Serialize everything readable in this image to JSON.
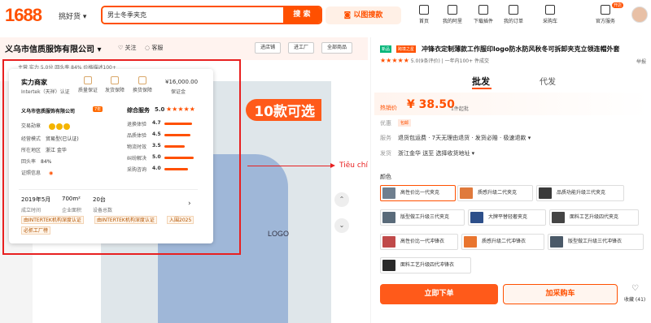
{
  "header": {
    "logo": "1688",
    "selector": "挑好货 ▾",
    "search_value": "男士冬季夹克",
    "search_button": "搜 索",
    "image_search": "以图搜款",
    "nav": [
      {
        "label": "首页",
        "icon": "home-icon"
      },
      {
        "label": "我的阿里",
        "icon": "user-icon"
      },
      {
        "label": "下载插件",
        "icon": "download-icon"
      },
      {
        "label": "我的订单",
        "icon": "order-icon"
      },
      {
        "label": "采购车",
        "icon": "cart-icon"
      },
      {
        "label": "官方服务",
        "icon": "service-icon"
      }
    ],
    "open_badge": "开店"
  },
  "store": {
    "name": "义乌市信质服饰有限公司 ▾",
    "follow": "关注",
    "follow2": "客服",
    "buttons": [
      "进店铺",
      "进工厂",
      "全部商品"
    ],
    "subbar": "主营  实力  5.0分  回头率 84%  价格描述100+"
  },
  "main_image": {
    "banner": "10款可选",
    "logo_print": "LOGO"
  },
  "popup": {
    "title": "实力商家",
    "cert": "Intertek（天祥）认证",
    "guarantees": [
      "质量保证",
      "发货保障",
      "换货保障"
    ],
    "money": "¥16,000.00",
    "money_label": "保证金",
    "company": "义乌市信质服饰有限公司",
    "years": "7年",
    "rows": [
      {
        "label": "交易勋章",
        "value": ""
      },
      {
        "label": "经营模式",
        "value": "贸易型(已认证)"
      },
      {
        "label": "所在地区",
        "value": "浙江 金华"
      },
      {
        "label": "回头率",
        "value": "84%"
      },
      {
        "label": "证照信息",
        "value": ""
      }
    ],
    "score_title": "综合服务",
    "score_value": "5.0",
    "stars": "★★★★★",
    "scores": [
      {
        "label": "退换体验",
        "value": "4.7",
        "pct": 0.94
      },
      {
        "label": "品质体验",
        "value": "4.5",
        "pct": 0.9
      },
      {
        "label": "物流时效",
        "value": "3.5",
        "pct": 0.7
      },
      {
        "label": "纠纷解决",
        "value": "5.0",
        "pct": 1.0
      },
      {
        "label": "采购咨询",
        "value": "4.0",
        "pct": 0.8
      }
    ],
    "facts": [
      {
        "value": "2019年5月",
        "label": "成立时间"
      },
      {
        "value": "700m²",
        "label": "企业面积"
      },
      {
        "value": "20台",
        "label": "设备总数"
      }
    ],
    "chevron": "›",
    "tags": [
      "由INTERTEK机构深度认证",
      "由INTERTEK机构深度认证",
      "入围2025",
      "必抓工厂榜"
    ]
  },
  "annotation": "Tiêu chí đánh giá độ uy tín của shop",
  "product": {
    "new_tag": "新品",
    "hot_tag": "跨境之星",
    "title": "冲锋衣定制薄款工作服印logo防水防风秋冬可拆卸夹克立领连帽外套",
    "stars": "★★★★★",
    "rating_text": "5.0(9条评价) | 一年内100+ 件成交",
    "report": "举报",
    "tab_wholesale": "批发",
    "tab_dropship": "代发",
    "price_label": "热销价",
    "price": "¥ 38.50",
    "price_min": "1件起批",
    "benefits_label": "优惠",
    "benefits_tag": "包邮",
    "service_label": "服务",
    "service": "退货包运费 · 7天无理由退货 · 发货必赔 · 极速退款 ▾",
    "ship_label": "发货",
    "ship": "浙江金华 送至 选择收货地址 ▾",
    "color_label": "颜色",
    "colors": [
      {
        "label": "高性价比一代夹克",
        "swatch": "#6f7f8f"
      },
      {
        "label": "质感升级二代夹克",
        "swatch": "#e07a3c"
      },
      {
        "label": "品质功能升级三代夹克",
        "swatch": "#3a3a3a"
      },
      {
        "label": "版型做工升级三代夹克",
        "swatch": "#5a6b7a"
      },
      {
        "label": "大牌平替轻奢夹克",
        "swatch": "#2d4f8a"
      },
      {
        "label": "面料工艺升级四代夹克",
        "swatch": "#444"
      },
      {
        "label": "高性价比一代冲锋衣",
        "swatch": "#c04a4a"
      },
      {
        "label": "质感升级二代冲锋衣",
        "swatch": "#e9752f"
      },
      {
        "label": "版型做工升级三代冲锋衣",
        "swatch": "#4a5968"
      },
      {
        "label": "面料工艺升级四代冲锋衣",
        "swatch": "#2a2a2a"
      }
    ],
    "buy": "立即下单",
    "cart": "加采购车",
    "fav": "收藏 (41)"
  }
}
